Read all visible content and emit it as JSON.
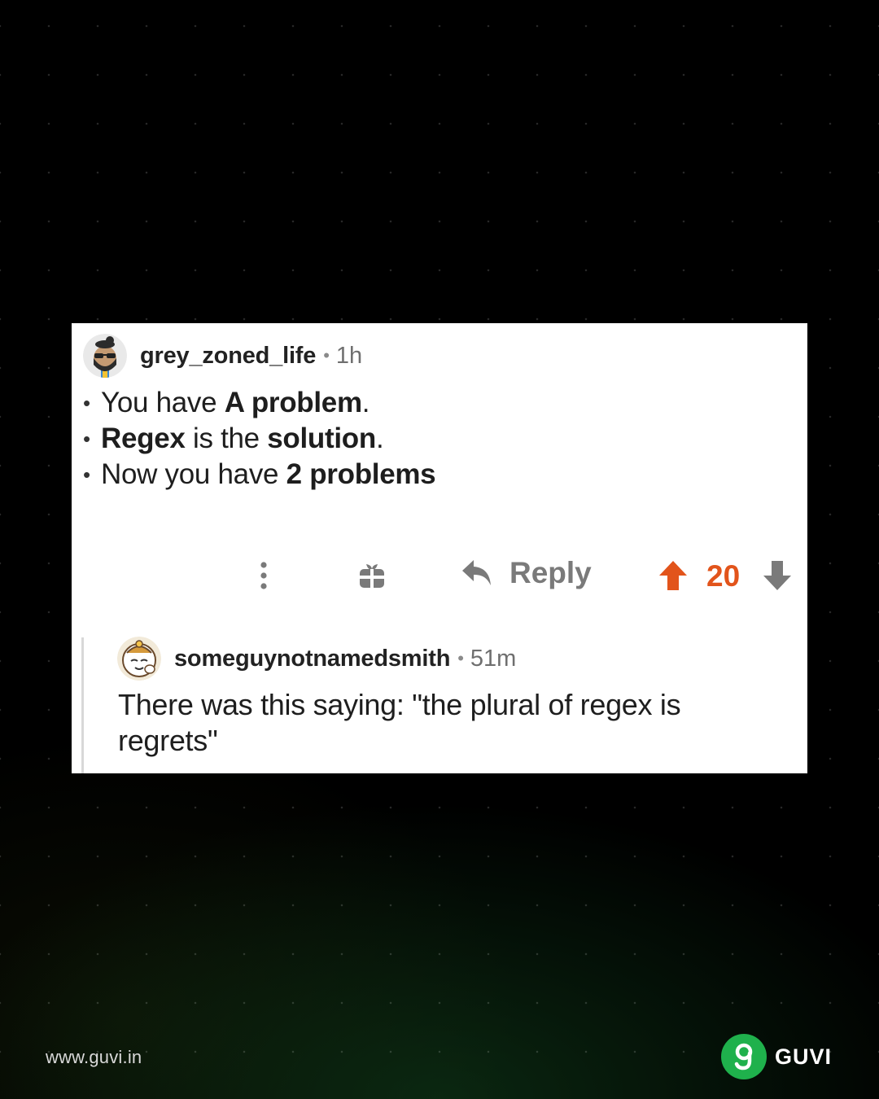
{
  "post": {
    "comment": {
      "username": "grey_zoned_life",
      "separator": "•",
      "time": "1h",
      "lines": [
        {
          "bullet": "•",
          "parts": [
            {
              "text": "You have ",
              "bold": false
            },
            {
              "text": "A problem",
              "bold": true
            },
            {
              "text": ".",
              "bold": false
            }
          ]
        },
        {
          "bullet": "•",
          "parts": [
            {
              "text": "Regex",
              "bold": true
            },
            {
              "text": " is the ",
              "bold": false
            },
            {
              "text": "solution",
              "bold": true
            },
            {
              "text": ".",
              "bold": false
            }
          ]
        },
        {
          "bullet": "•",
          "parts": [
            {
              "text": "Now you have ",
              "bold": false
            },
            {
              "text": "2 problems",
              "bold": true
            }
          ]
        }
      ]
    },
    "actions": {
      "more_icon": "vertical-ellipsis-icon",
      "gift_icon": "gift-icon",
      "reply_icon": "reply-arrow-icon",
      "reply_label": "Reply",
      "upvote_icon": "upvote-arrow-icon",
      "vote_count": "20",
      "downvote_icon": "downvote-arrow-icon",
      "upvote_color": "#e2541b",
      "icon_color": "#7a7a7a"
    },
    "reply": {
      "username": "someguynotnamedsmith",
      "separator": "•",
      "time": "51m",
      "text": "There was this saying: \"the plural of regex is regrets\""
    }
  },
  "footer": {
    "url": "www.guvi.in",
    "brand_name": "GUVI",
    "brand_color": "#1fb14c"
  }
}
